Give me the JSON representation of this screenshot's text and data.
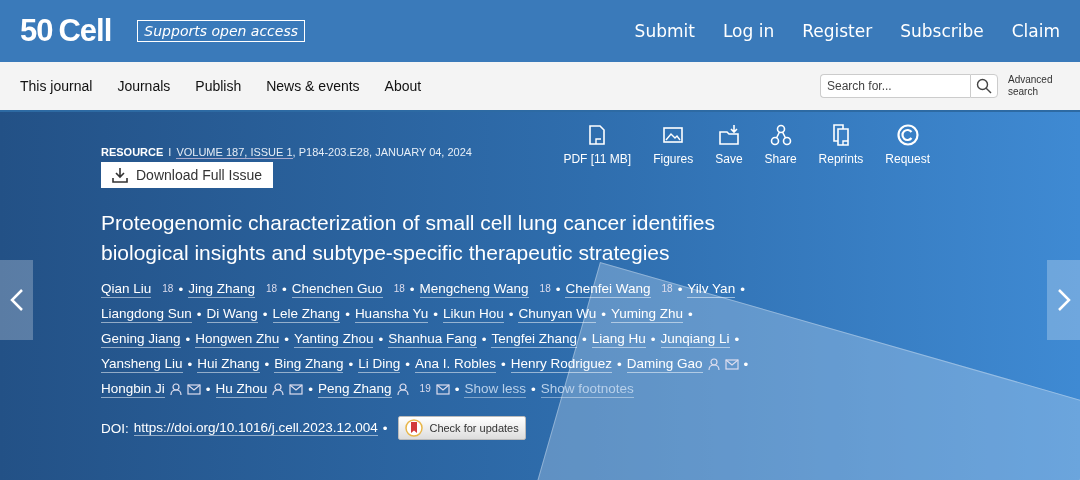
{
  "header": {
    "logo_mark": "50",
    "logo_name": "Cell",
    "open_access_badge": "Supports open access",
    "links": [
      "Submit",
      "Log in",
      "Register",
      "Subscribe",
      "Claim"
    ]
  },
  "nav": {
    "items": [
      "This journal",
      "Journals",
      "Publish",
      "News & events",
      "About"
    ],
    "search": {
      "placeholder": "Search for..."
    },
    "advanced_search": "Advanced search"
  },
  "article": {
    "type": "RESOURCE",
    "separator": "I",
    "volume": "VOLUME 187, ISSUE 1",
    "pages_date": ", P184-203.E28, JANUARY 04, 2024",
    "download_button": "Download Full Issue",
    "actions": [
      {
        "kind": "pdf",
        "label": "PDF [11 MB]"
      },
      {
        "kind": "figures",
        "label": "Figures"
      },
      {
        "kind": "save",
        "label": "Save"
      },
      {
        "kind": "share",
        "label": "Share"
      },
      {
        "kind": "reprints",
        "label": "Reprints"
      },
      {
        "kind": "request",
        "label": "Request"
      }
    ],
    "title": "Proteogenomic characterization of small cell lung cancer identifies biological insights and subtype-specific therapeutic strategies",
    "authors": [
      {
        "name": "Qian Liu",
        "note": "18",
        "corresponding": false
      },
      {
        "name": "Jing Zhang",
        "note": "18",
        "corresponding": false
      },
      {
        "name": "Chenchen Guo",
        "note": "18",
        "corresponding": false
      },
      {
        "name": "Mengcheng Wang",
        "note": "18",
        "corresponding": false
      },
      {
        "name": "Chenfei Wang",
        "note": "18",
        "corresponding": false
      },
      {
        "name": "Yilv Yan",
        "corresponding": false
      },
      {
        "name": "Liangdong Sun",
        "corresponding": false
      },
      {
        "name": "Di Wang",
        "corresponding": false
      },
      {
        "name": "Lele Zhang",
        "corresponding": false
      },
      {
        "name": "Huansha Yu",
        "corresponding": false
      },
      {
        "name": "Likun Hou",
        "corresponding": false
      },
      {
        "name": "Chunyan Wu",
        "corresponding": false
      },
      {
        "name": "Yuming Zhu",
        "corresponding": false
      },
      {
        "name": "Gening Jiang",
        "corresponding": false
      },
      {
        "name": "Hongwen Zhu",
        "corresponding": false
      },
      {
        "name": "Yanting Zhou",
        "corresponding": false
      },
      {
        "name": "Shanhua Fang",
        "corresponding": false
      },
      {
        "name": "Tengfei Zhang",
        "corresponding": false
      },
      {
        "name": "Liang Hu",
        "corresponding": false
      },
      {
        "name": "Junqiang Li",
        "corresponding": false
      },
      {
        "name": "Yansheng Liu",
        "corresponding": false
      },
      {
        "name": "Hui Zhang",
        "corresponding": false
      },
      {
        "name": "Bing Zhang",
        "corresponding": false
      },
      {
        "name": "Li Ding",
        "corresponding": false
      },
      {
        "name": "Ana I. Robles",
        "corresponding": false
      },
      {
        "name": "Henry Rodriguez",
        "corresponding": false
      },
      {
        "name": "Daming Gao",
        "corresponding": true
      },
      {
        "name": "Hongbin Ji",
        "corresponding": true
      },
      {
        "name": "Hu Zhou",
        "corresponding": true
      },
      {
        "name": "Peng Zhang",
        "note": "19",
        "corresponding": true
      }
    ],
    "bullet": "•",
    "show_less": "Show less",
    "show_footnotes": "Show footnotes",
    "doi_label": "DOI:",
    "doi": "https://doi.org/10.1016/j.cell.2023.12.004",
    "check_updates": "Check for updates"
  }
}
